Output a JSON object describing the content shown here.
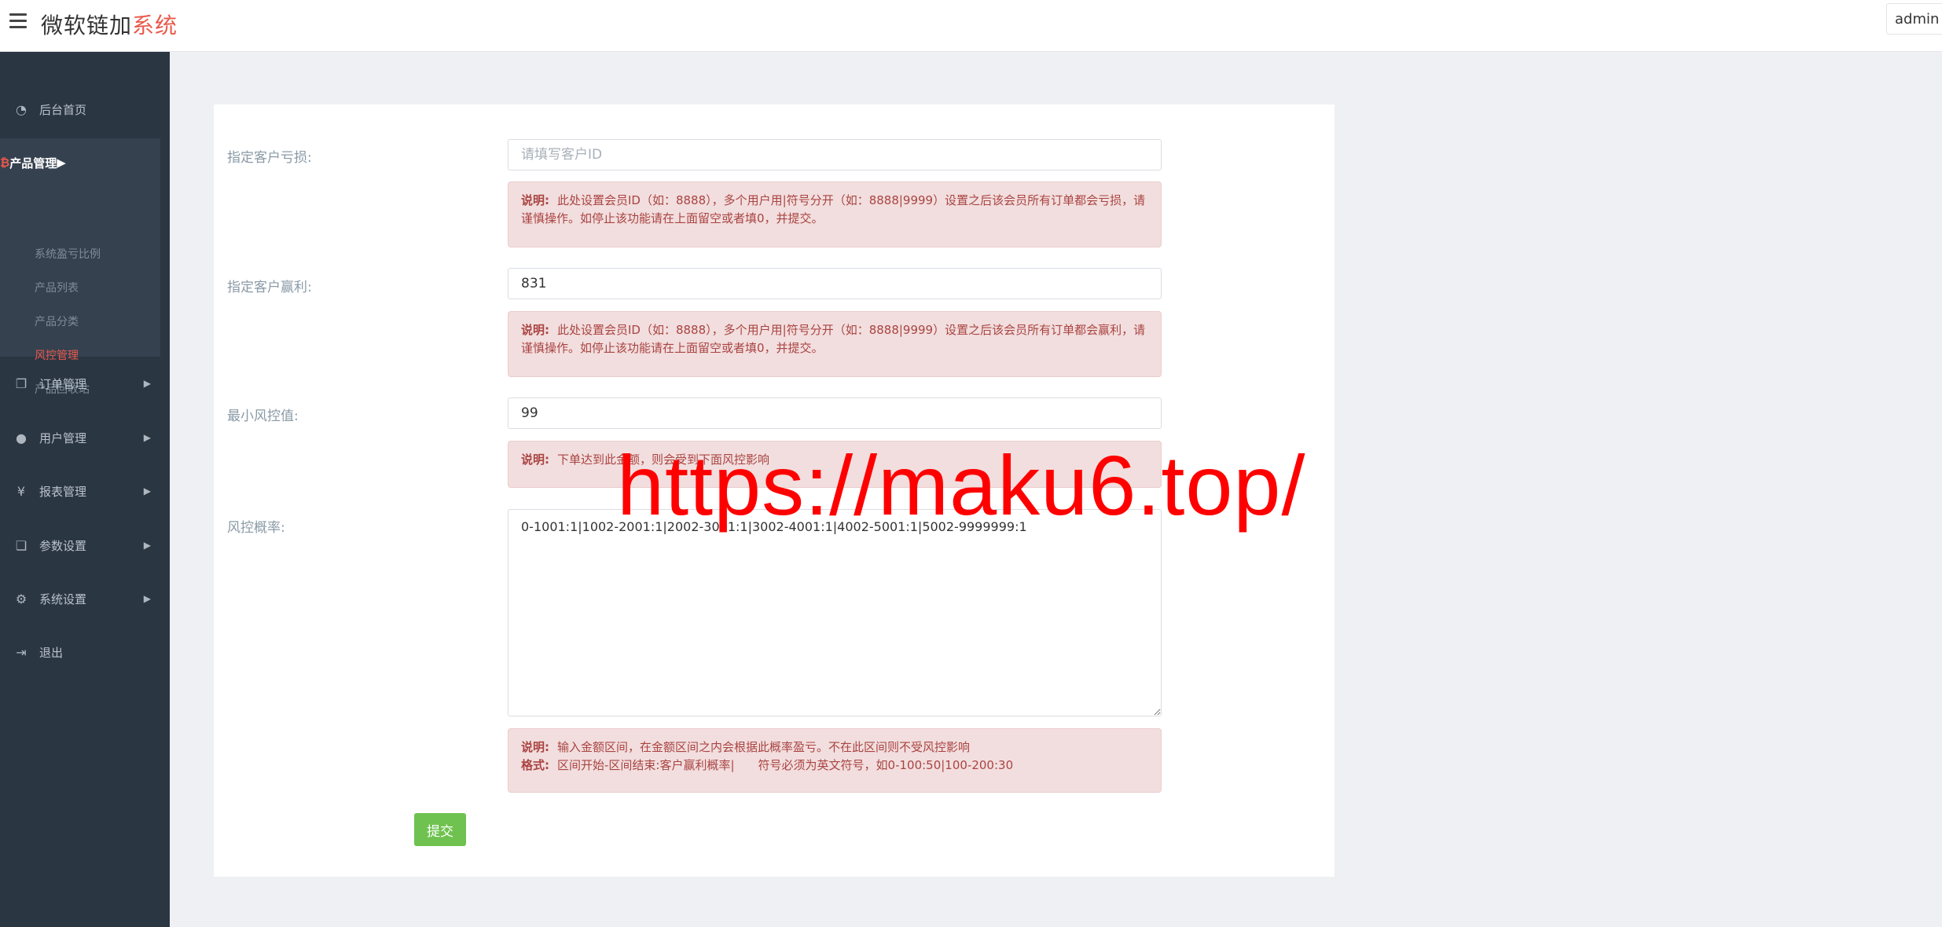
{
  "header": {
    "brand_main": "微软链加",
    "brand_accent": "系统",
    "user": "admin",
    "menu_icon": "hamburger-icon"
  },
  "sidebar": {
    "items": [
      {
        "label": "后台首页",
        "icon": "dashboard-icon"
      },
      {
        "label": "订单管理",
        "icon": "orders-icon"
      },
      {
        "label": "用户管理",
        "icon": "user-icon"
      },
      {
        "label": "报表管理",
        "icon": "yen-icon"
      },
      {
        "label": "参数设置",
        "icon": "settings-doc-icon"
      },
      {
        "label": "系统设置",
        "icon": "gears-icon"
      },
      {
        "label": "退出",
        "icon": "logout-icon"
      }
    ],
    "product_group": {
      "label": "产品管理",
      "icon": "bitcoin-icon",
      "subitems": [
        "系统盈亏比例",
        "产品列表",
        "产品分类",
        "风控管理",
        "产品回收站"
      ],
      "active": "风控管理"
    }
  },
  "form": {
    "loss_label": "指定客户亏损:",
    "loss_placeholder": "请填写客户ID",
    "loss_note_title": "说明:",
    "loss_note_text": "此处设置会员ID（如：8888），多个用户用|符号分开（如：8888|9999）设置之后该会员所有订单都会亏损，请谨慎操作。如停止该功能请在上面留空或者填0，并提交。",
    "win_label": "指定客户赢利:",
    "win_value": "831",
    "win_note_title": "说明:",
    "win_note_text": "此处设置会员ID（如：8888），多个用户用|符号分开（如：8888|9999）设置之后该会员所有订单都会赢利，请谨慎操作。如停止该功能请在上面留空或者填0，并提交。",
    "min_label": "最小风控值:",
    "min_value": "99",
    "min_note_title": "说明:",
    "min_note_text": "下单达到此金额，则会受到下面风控影响",
    "rate_label": "风控概率:",
    "rate_value": "0-1001:1|1002-2001:1|2002-3001:1|3002-4001:1|4002-5001:1|5002-9999999:1",
    "rate_note_title": "说明:",
    "rate_note_text": "输入金额区间，在金额区间之内会根据此概率盈亏。不在此区间则不受风控影响",
    "rate_format_title": "格式:",
    "rate_format_text": "区间开始-区间结束:客户赢利概率|　　符号必须为英文符号，如0-100:50|100-200:30",
    "submit_label": "提交"
  },
  "watermark": "https://maku6.top/",
  "colors": {
    "sidebar_bg": "#2b3643",
    "accent_red": "#e9594b",
    "note_bg": "#f2dede",
    "note_text": "#a94442",
    "submit_green": "#6fc24f",
    "watermark_red": "#ff0000"
  }
}
